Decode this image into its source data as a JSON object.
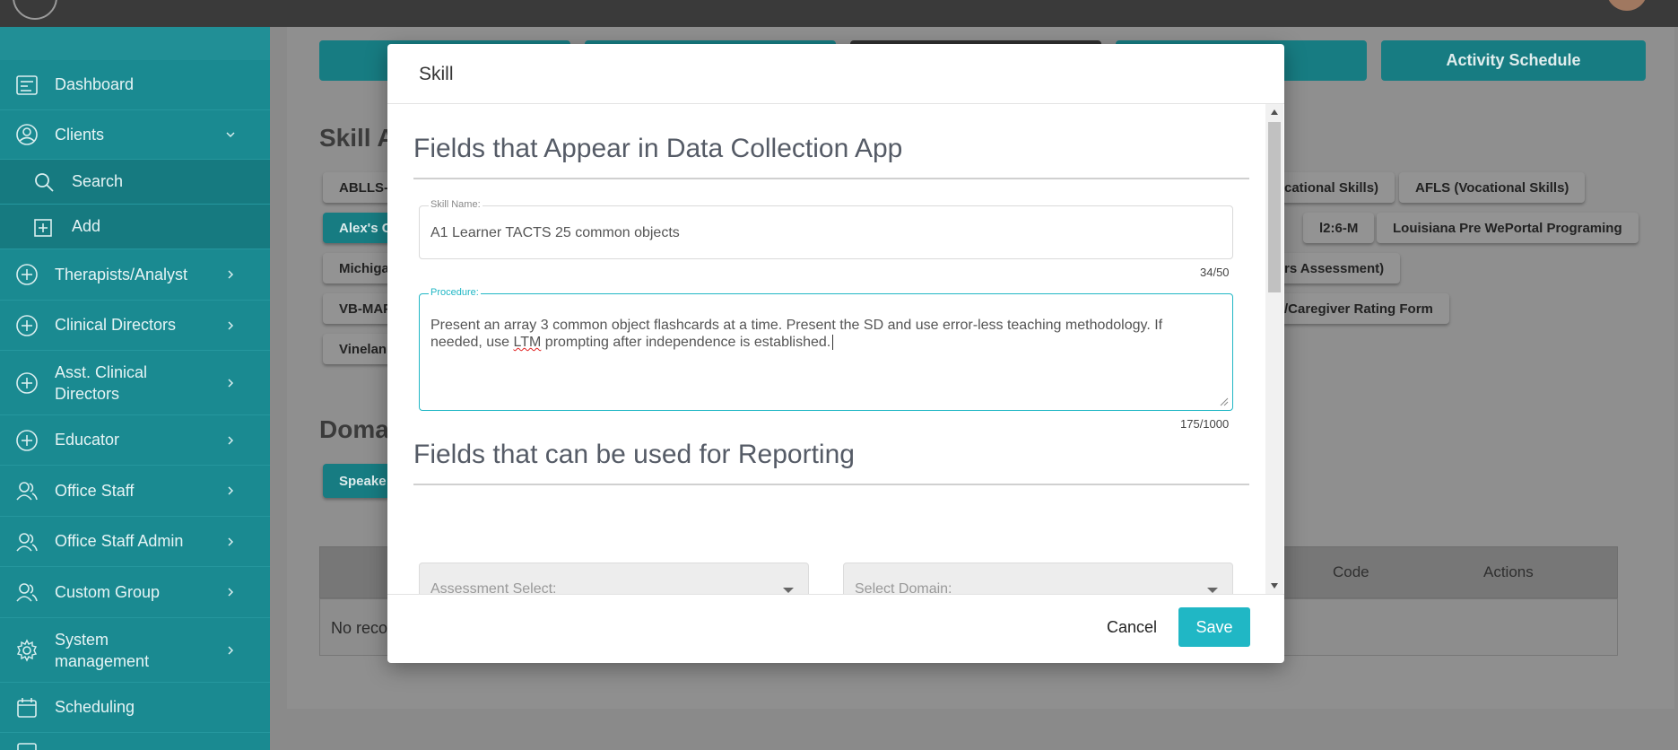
{
  "colors": {
    "accent": "#20b7c5",
    "sidebar": "#1a8a91",
    "topbar": "#3a3a3a"
  },
  "sidebar": {
    "items": [
      {
        "label": "Dashboard",
        "icon": "dashboard-icon"
      },
      {
        "label": "Clients",
        "icon": "user-circle-icon",
        "expanded": true
      },
      {
        "label": "Search",
        "icon": "search-icon"
      },
      {
        "label": "Add",
        "icon": "add-square-icon"
      },
      {
        "label": "Therapists/Analyst",
        "icon": "plus-circle-icon"
      },
      {
        "label": "Clinical Directors",
        "icon": "plus-circle-icon"
      },
      {
        "label": "Asst. Clinical Directors",
        "icon": "plus-circle-icon"
      },
      {
        "label": "Educator",
        "icon": "plus-circle-icon"
      },
      {
        "label": "Office Staff",
        "icon": "users-icon"
      },
      {
        "label": "Office Staff Admin",
        "icon": "users-icon"
      },
      {
        "label": "Custom Group",
        "icon": "users-icon"
      },
      {
        "label": "System management",
        "icon": "gear-icon"
      },
      {
        "label": "Scheduling",
        "icon": "calendar-icon"
      }
    ]
  },
  "background": {
    "top_tabs": [
      "Activity Schedule"
    ],
    "skill_heading": "Skill A",
    "domain_heading": "Doma",
    "chips": {
      "c1": "ABLLS-I",
      "c2": "Alex's C",
      "c3": "Michiga",
      "c4": "VB-MAP",
      "c5": "Vinelan",
      "c6": "cational Skills)",
      "c7": "AFLS (Vocational Skills)",
      "c8": "l2:6-M",
      "c9": "Louisiana Pre WePortal Programing",
      "c10": "rs Assessment)",
      "c11": "/Caregiver Rating Form",
      "c12": "Speake"
    },
    "table": {
      "col_code": "Code",
      "col_actions": "Actions",
      "empty": "No reco"
    }
  },
  "modal": {
    "title": "Skill",
    "section_app": "Fields that Appear in Data Collection App",
    "skill_name": {
      "label": "Skill Name:",
      "value": "A1 Learner TACTS 25 common objects",
      "counter": "34/50"
    },
    "procedure": {
      "label": "Procedure:",
      "line1": "Present an array 3 common object flashcards at a time. Present the SD and use error-less teaching methodology. If",
      "line2_pre": "needed, use ",
      "line2_spell": "LTM",
      "line2_post": " prompting after independence is established.",
      "counter": "175/1000"
    },
    "section_reporting": "Fields that can be used for Reporting",
    "assessment_select": {
      "placeholder": "Assessment Select:"
    },
    "domain_select": {
      "placeholder": "Select Domain:"
    },
    "cancel_label": "Cancel",
    "save_label": "Save"
  }
}
